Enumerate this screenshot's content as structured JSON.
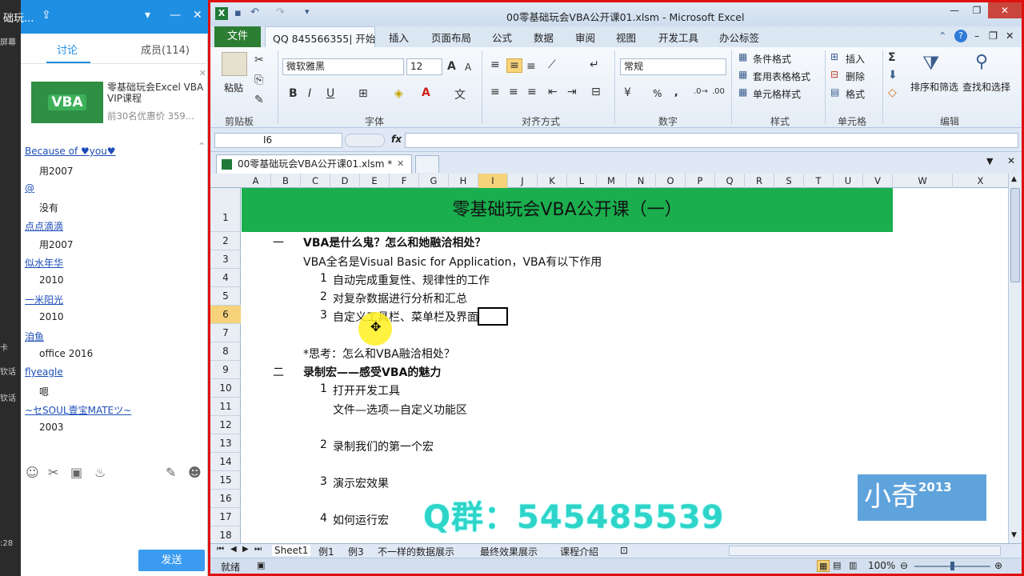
{
  "left_strip": {
    "items": [
      "屏幕",
      "卡",
      "钦话",
      "钦话",
      ":28"
    ]
  },
  "chat": {
    "title": "础玩...",
    "tabs": [
      "讨论",
      "成员(114)"
    ],
    "ad": {
      "title": "零基础玩会Excel VBA VIP课程",
      "price": "前30名优惠价 359...",
      "img_text": "VBA"
    },
    "messages": [
      {
        "name": "Because of ♥you♥",
        "text": "用2007"
      },
      {
        "name": "@",
        "text": "没有"
      },
      {
        "name": "点点滴滴",
        "text": "用2007"
      },
      {
        "name": "似水年华",
        "text": "2010"
      },
      {
        "name": "一米阳光",
        "text": "2010"
      },
      {
        "name": "洎鱼",
        "text": "office 2016"
      },
      {
        "name": "flyeagle",
        "text": "嗯"
      },
      {
        "name": "~セSOUL壹宝MATEツ~",
        "text": "2003"
      }
    ],
    "send_label": "发送"
  },
  "excel": {
    "title": "00零基础玩会VBA公开课01.xlsm - Microsoft Excel",
    "menu": {
      "file": "文件",
      "home": "QQ 845566355| 开始",
      "tabs": [
        "插入",
        "页面布局",
        "公式",
        "数据",
        "审阅",
        "视图",
        "开发工具",
        "办公标签"
      ]
    },
    "ribbon": {
      "clipboard": {
        "paste": "粘贴",
        "label": "剪贴板"
      },
      "font": {
        "name": "微软雅黑",
        "size": "12",
        "label": "字体"
      },
      "align": {
        "label": "对齐方式"
      },
      "number": {
        "format": "常规",
        "label": "数字",
        "pct": "%",
        "comma": ","
      },
      "styles": {
        "cond": "条件格式",
        "table": "套用表格格式",
        "cell": "单元格样式",
        "label": "样式"
      },
      "cells": {
        "insert": "插入",
        "delete": "删除",
        "format": "格式",
        "label": "单元格"
      },
      "edit": {
        "sort": "排序和筛选",
        "find": "查找和选择",
        "label": "编辑"
      }
    },
    "namebox": "I6",
    "doc_tab": "00零基础玩会VBA公开课01.xlsm *",
    "columns": [
      "A",
      "B",
      "C",
      "D",
      "E",
      "F",
      "G",
      "H",
      "I",
      "J",
      "K",
      "L",
      "M",
      "N",
      "O",
      "P",
      "Q",
      "R",
      "S",
      "T",
      "U",
      "V",
      "W",
      "X"
    ],
    "rows": [
      "1",
      "2",
      "3",
      "4",
      "5",
      "6",
      "7",
      "8",
      "9",
      "10",
      "11",
      "12",
      "13",
      "14",
      "15",
      "16",
      "17",
      "18"
    ],
    "selected_col": "I",
    "selected_row": "6",
    "banner": "零基础玩会VBA公开课（一）",
    "cells": {
      "r2a": "一",
      "r2": "VBA是什么鬼？怎么和她融洽相处？",
      "r3": "VBA全名是Visual Basic for Application，VBA有以下作用",
      "r4n": "1",
      "r4": "自动完成重复性、规律性的工作",
      "r5n": "2",
      "r5": "对复杂数据进行分析和汇总",
      "r6n": "3",
      "r6": "自定义工具栏、菜单栏及界面",
      "r8": "*思考：怎么和VBA融洽相处？",
      "r9a": "二",
      "r9": "录制宏——感受VBA的魅力",
      "r10n": "1",
      "r10": "打开开发工具",
      "r11": "文件—选项—自定义功能区",
      "r13n": "2",
      "r13": "录制我们的第一个宏",
      "r15n": "3",
      "r15": "演示宏效果",
      "r17n": "4",
      "r17": "如何运行宏"
    },
    "watermark_qq": "Q群：545485539",
    "watermark_logo": "小奇",
    "watermark_logo_year": "2013",
    "sheets": [
      "Sheet1",
      "例1",
      "例3",
      "不一样的数据展示",
      "最终效果展示",
      "课程介绍"
    ],
    "status": "就绪",
    "zoom": "100%"
  }
}
